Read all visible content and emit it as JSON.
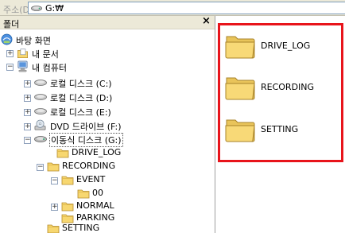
{
  "address_bar": {
    "label": "주소(D)",
    "path": "G:₩"
  },
  "folders_pane": {
    "title": "폴더",
    "close_glyph": "×"
  },
  "tree": {
    "desktop": "바탕 화면",
    "my_documents": "내 문서",
    "my_computer": "내 컴퓨터",
    "disk_c": "로컬 디스크 (C:)",
    "disk_d": "로컬 디스크 (D:)",
    "disk_e": "로컬 디스크 (E:)",
    "dvd_f": "DVD 드라이브 (F:)",
    "removable_g": "이동식 디스크 (G:)",
    "drive_log": "DRIVE_LOG",
    "recording": "RECORDING",
    "event": "EVENT",
    "event_00": "00",
    "normal": "NORMAL",
    "parking": "PARKING",
    "setting": "SETTING"
  },
  "expander": {
    "plus": "+",
    "minus": "−"
  },
  "content_items": [
    {
      "label": "DRIVE_LOG",
      "icon": "folder-icon"
    },
    {
      "label": "RECORDING",
      "icon": "folder-icon"
    },
    {
      "label": "SETTING",
      "icon": "folder-icon"
    }
  ],
  "colors": {
    "highlight_border": "#e8141b",
    "folder_yellow": "#f7d770",
    "toolbar_bg": "#ece9d8"
  }
}
